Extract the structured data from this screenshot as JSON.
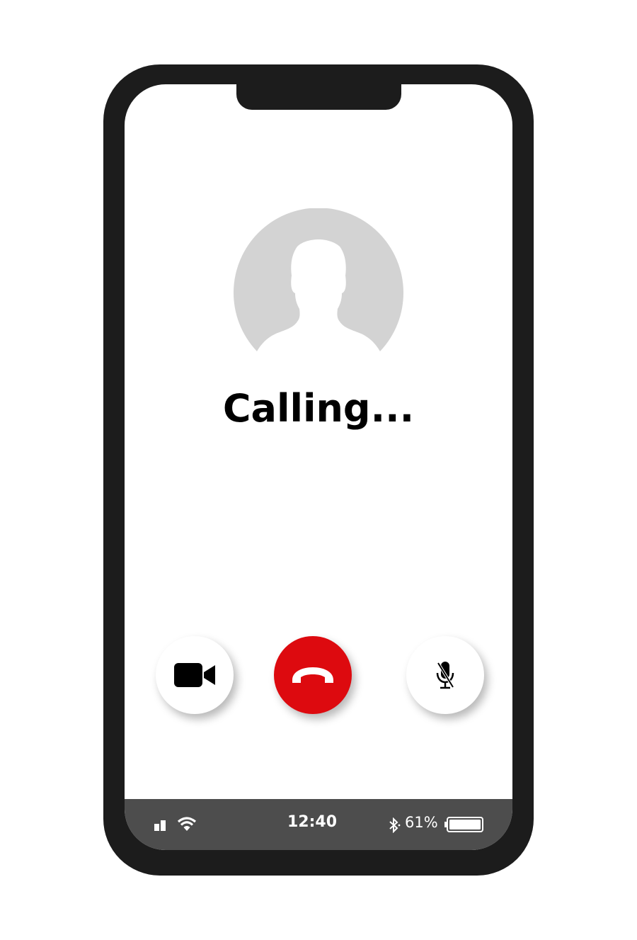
{
  "call": {
    "status_text": "Calling..."
  },
  "controls": {
    "video_icon": "video-camera-icon",
    "end_icon": "phone-hangup-icon",
    "mute_icon": "microphone-muted-icon",
    "end_color": "#dd0a0f"
  },
  "status_bar": {
    "time": "12:40",
    "battery_percent": "61%",
    "signal_icon": "signal-bars-icon",
    "wifi_icon": "wifi-icon",
    "bluetooth_icon": "bluetooth-icon",
    "battery_icon": "battery-icon",
    "battery_level": 0.61
  }
}
